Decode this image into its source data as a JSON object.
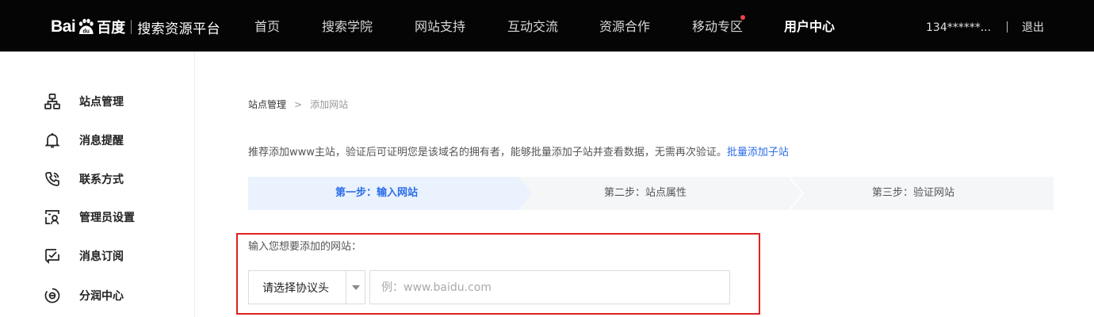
{
  "header": {
    "logo": {
      "bai": "Bai",
      "du_mark": "du",
      "cn": "百度",
      "subtitle": "搜索资源平台"
    },
    "nav": [
      {
        "label": "首页",
        "active": false
      },
      {
        "label": "搜索学院",
        "active": false
      },
      {
        "label": "网站支持",
        "active": false
      },
      {
        "label": "互动交流",
        "active": false
      },
      {
        "label": "资源合作",
        "active": false
      },
      {
        "label": "移动专区",
        "active": false,
        "badge_dot": true
      },
      {
        "label": "用户中心",
        "active": true
      }
    ],
    "user_name": "134******...",
    "logout_label": "退出"
  },
  "sidebar": {
    "items": [
      {
        "label": "站点管理",
        "icon": "sitemap-icon"
      },
      {
        "label": "消息提醒",
        "icon": "bell-icon"
      },
      {
        "label": "联系方式",
        "icon": "phone-icon"
      },
      {
        "label": "管理员设置",
        "icon": "admin-id-icon"
      },
      {
        "label": "消息订阅",
        "icon": "subscribe-check-icon"
      },
      {
        "label": "分润中心",
        "icon": "revenue-icon"
      }
    ]
  },
  "breadcrumb": {
    "parent": "站点管理",
    "separator": ">",
    "current": "添加网站"
  },
  "notice": {
    "text": "推荐添加www主站，验证后可证明您是该域名的拥有者，能够批量添加子站并查看数据，无需再次验证。",
    "link": "批量添加子站"
  },
  "steps": [
    {
      "label": "第一步：输入网站",
      "active": true
    },
    {
      "label": "第二步：站点属性",
      "active": false
    },
    {
      "label": "第三步：验证网站",
      "active": false
    }
  ],
  "form": {
    "caption": "输入您想要添加的网站：",
    "protocol_select": "请选择协议头",
    "url_placeholder": "例：www.baidu.com",
    "url_value": ""
  },
  "colors": {
    "topbar_bg": "#050505",
    "accent_blue": "#2d6de8",
    "highlight_red": "#e02020",
    "badge_red": "#f0424b"
  }
}
